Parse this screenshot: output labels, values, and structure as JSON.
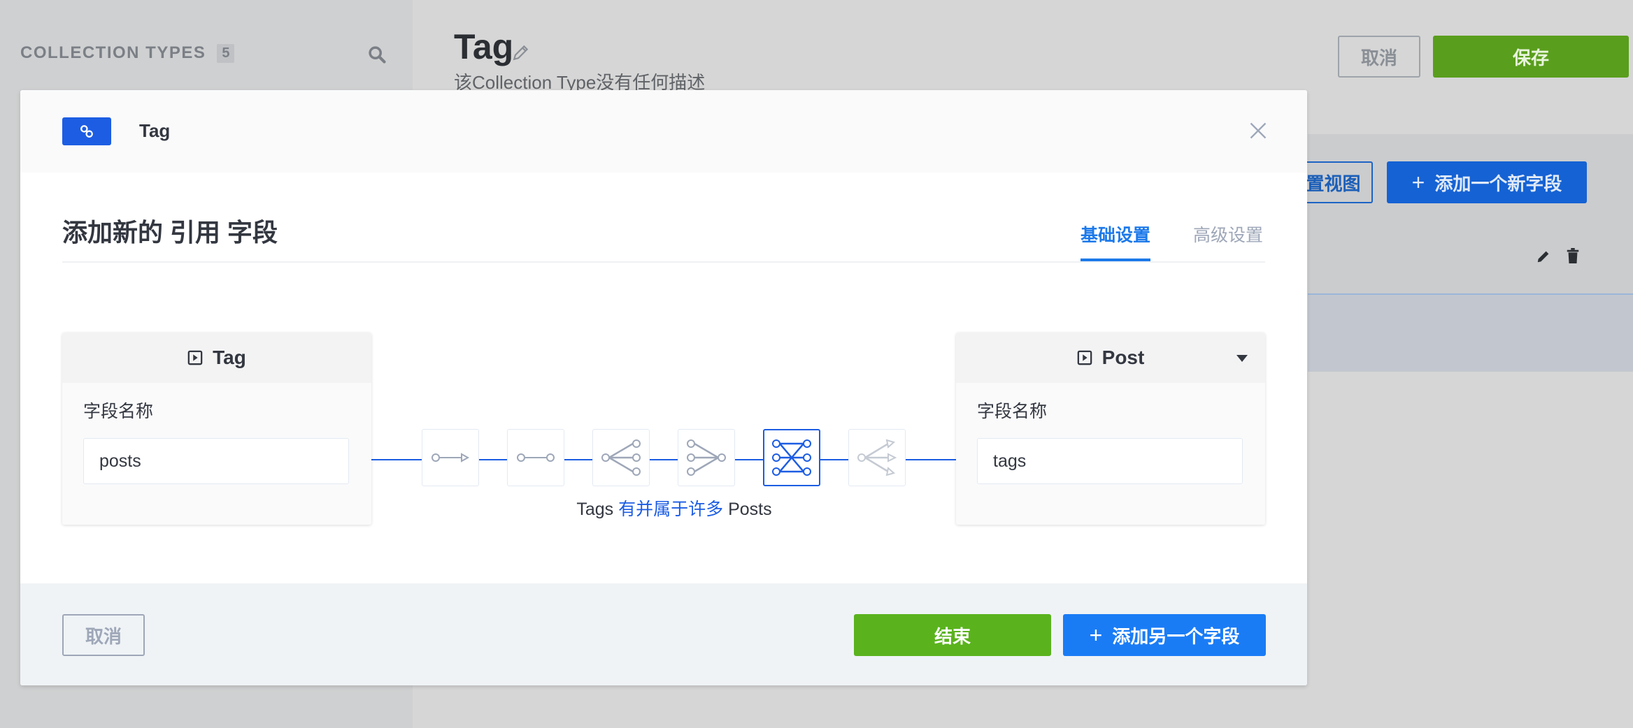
{
  "sidebar": {
    "section_title": "COLLECTION TYPES",
    "section_count": "5"
  },
  "header": {
    "title": "Tag",
    "description": "该Collection Type没有任何描述",
    "cancel_label": "取消",
    "save_label": "保存"
  },
  "background": {
    "config_view_label": "置视图",
    "add_field_label": "添加一个新字段",
    "add_field_plus": "+"
  },
  "modal": {
    "header_title": "Tag",
    "heading": "添加新的 引用 字段",
    "tabs": [
      {
        "label": "基础设置",
        "active": true
      },
      {
        "label": "高级设置",
        "active": false
      }
    ],
    "left_card": {
      "title": "Tag",
      "field_label": "字段名称",
      "field_value": "posts"
    },
    "right_card": {
      "title": "Post",
      "field_label": "字段名称",
      "field_value": "tags"
    },
    "relation_types": [
      {
        "icon": "one-way-relation-icon",
        "active": false
      },
      {
        "icon": "one-to-one-relation-icon",
        "active": false
      },
      {
        "icon": "one-to-many-relation-icon",
        "active": false
      },
      {
        "icon": "many-to-one-relation-icon",
        "active": false
      },
      {
        "icon": "many-to-many-relation-icon",
        "active": true
      },
      {
        "icon": "many-way-relation-icon",
        "active": false
      }
    ],
    "caption": {
      "left": "Tags",
      "middle": "有并属于许多",
      "right": "Posts"
    },
    "footer": {
      "cancel_label": "取消",
      "finish_label": "结束",
      "add_another_label": "添加另一个字段",
      "add_another_plus": "+"
    }
  },
  "colors": {
    "primary_blue": "#1c5de3",
    "tab_blue": "#1c79ea",
    "green": "#5ab31d",
    "footer_bg": "#eff3f6"
  }
}
